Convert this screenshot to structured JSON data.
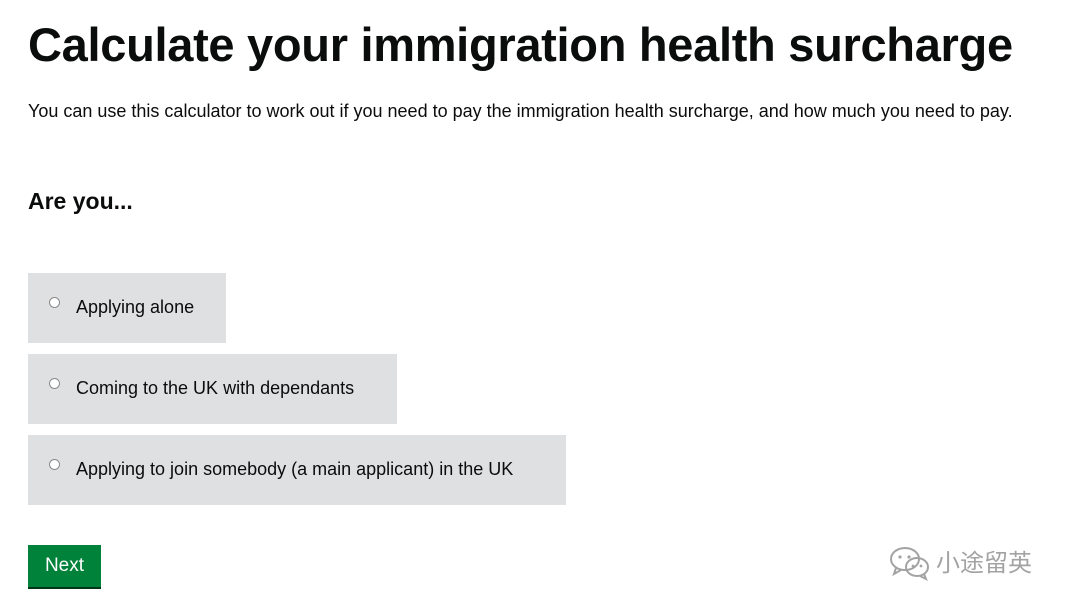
{
  "page": {
    "title": "Calculate your immigration health surcharge",
    "intro": "You can use this calculator to work out if you need to pay the immigration health surcharge, and how much you need to pay."
  },
  "form": {
    "question": "Are you...",
    "options": [
      {
        "label": "Applying alone",
        "selected": false
      },
      {
        "label": "Coming to the UK with dependants",
        "selected": false
      },
      {
        "label": "Applying to join somebody (a main applicant) in the UK",
        "selected": false
      }
    ],
    "next_label": "Next"
  },
  "watermark": {
    "text": "小途留英",
    "icon": "wechat-icon"
  },
  "colors": {
    "text": "#0b0c0c",
    "option_bg": "#dee0e2",
    "button_bg": "#00823b",
    "button_text": "#ffffff",
    "watermark": "#9a9a9a"
  }
}
